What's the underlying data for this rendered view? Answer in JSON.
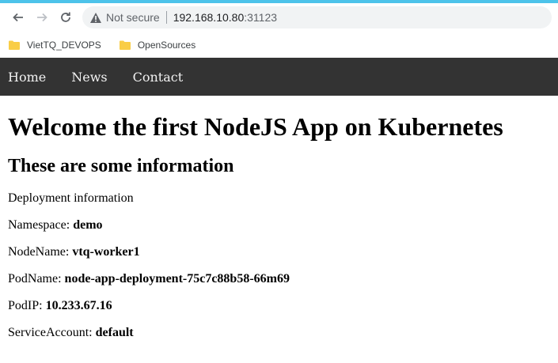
{
  "browser": {
    "security_label": "Not secure",
    "url_host": "192.168.10.80",
    "url_port": ":31123",
    "colors": {
      "accent": "#4dc3ea",
      "omnibox": "#f1f3f4"
    },
    "bookmarks": [
      {
        "label": "VietTQ_DEVOPS",
        "icon": "folder-icon"
      },
      {
        "label": "OpenSources",
        "icon": "folder-icon"
      }
    ]
  },
  "nav": {
    "items": [
      "Home",
      "News",
      "Contact"
    ],
    "background": "#333333"
  },
  "page": {
    "title": "Welcome the first NodeJS App on Kubernetes",
    "subtitle": "These are some information",
    "section_label": "Deployment information",
    "fields": [
      {
        "label": "Namespace: ",
        "value": "demo"
      },
      {
        "label": "NodeName: ",
        "value": "vtq-worker1"
      },
      {
        "label": "PodName: ",
        "value": "node-app-deployment-75c7c88b58-66m69"
      },
      {
        "label": "PodIP: ",
        "value": "10.233.67.16"
      },
      {
        "label": "ServiceAccount: ",
        "value": "default"
      }
    ]
  }
}
